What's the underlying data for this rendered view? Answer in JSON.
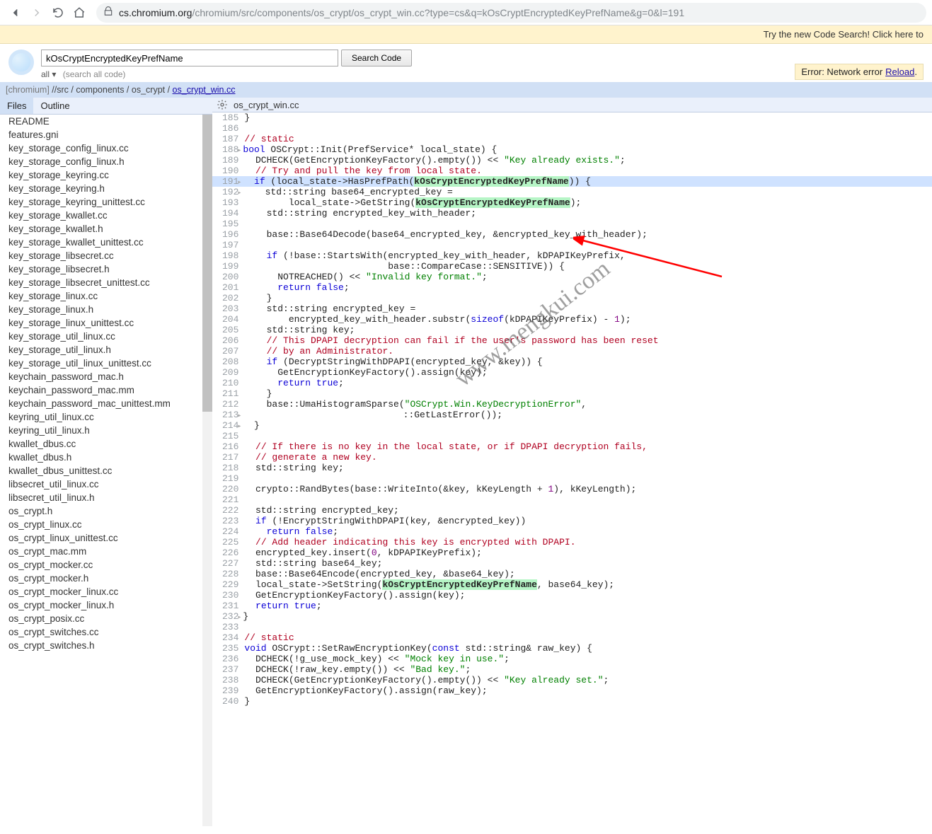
{
  "browser": {
    "url_host": "cs.chromium.org",
    "url_path": "/chromium/src/components/os_crypt/os_crypt_win.cc?type=cs&q=kOsCryptEncryptedKeyPrefName&g=0&l=191"
  },
  "banner_text": "Try the new Code Search! Click here to",
  "search": {
    "value": "kOsCryptEncryptedKeyPrefName",
    "button": "Search Code",
    "scope": "all ▾",
    "sub": "(search all code)"
  },
  "error": {
    "prefix": "Error: Network error ",
    "reload": "Reload",
    "dot": "."
  },
  "crumb": {
    "project": "[chromium]",
    "parts": [
      "src",
      "components",
      "os_crypt"
    ],
    "file": "os_crypt_win.cc"
  },
  "side_tabs": {
    "files": "Files",
    "outline": "Outline"
  },
  "files": [
    "README",
    "features.gni",
    "key_storage_config_linux.cc",
    "key_storage_config_linux.h",
    "key_storage_keyring.cc",
    "key_storage_keyring.h",
    "key_storage_keyring_unittest.cc",
    "key_storage_kwallet.cc",
    "key_storage_kwallet.h",
    "key_storage_kwallet_unittest.cc",
    "key_storage_libsecret.cc",
    "key_storage_libsecret.h",
    "key_storage_libsecret_unittest.cc",
    "key_storage_linux.cc",
    "key_storage_linux.h",
    "key_storage_linux_unittest.cc",
    "key_storage_util_linux.cc",
    "key_storage_util_linux.h",
    "key_storage_util_linux_unittest.cc",
    "keychain_password_mac.h",
    "keychain_password_mac.mm",
    "keychain_password_mac_unittest.mm",
    "keyring_util_linux.cc",
    "keyring_util_linux.h",
    "kwallet_dbus.cc",
    "kwallet_dbus.h",
    "kwallet_dbus_unittest.cc",
    "libsecret_util_linux.cc",
    "libsecret_util_linux.h",
    "os_crypt.h",
    "os_crypt_linux.cc",
    "os_crypt_linux_unittest.cc",
    "os_crypt_mac.mm",
    "os_crypt_mocker.cc",
    "os_crypt_mocker.h",
    "os_crypt_mocker_linux.cc",
    "os_crypt_mocker_linux.h",
    "os_crypt_posix.cc",
    "os_crypt_switches.cc",
    "os_crypt_switches.h"
  ],
  "code_title": "os_crypt_win.cc",
  "watermark": "www.mengkui.com",
  "code": [
    {
      "n": 185,
      "t": "}"
    },
    {
      "n": 186,
      "t": ""
    },
    {
      "n": 187,
      "t": "<span class='c-com'>// static</span>"
    },
    {
      "n": 188,
      "t": "<span class='c-kw'>bool</span> OSCrypt::Init(PrefService* local_state) {",
      "fold": true
    },
    {
      "n": 189,
      "t": "  DCHECK(GetEncryptionKeyFactory().empty()) &lt;&lt; <span class='c-str'>\"Key already exists.\"</span>;"
    },
    {
      "n": 190,
      "t": "  <span class='c-com'>// Try and pull the key from local state.</span>"
    },
    {
      "n": 191,
      "hl": true,
      "t": "  <span class='c-kw'>if</span> (local_state-&gt;HasPrefPath(<span class='hl-tok'>kOsCryptEncryptedKeyPrefName</span>)) {",
      "fold": true
    },
    {
      "n": 192,
      "t": "    std::string base64_encrypted_key =",
      "fold": true
    },
    {
      "n": 193,
      "t": "        local_state-&gt;GetString(<span class='hl-tok'>kOsCryptEncryptedKeyPrefName</span>);"
    },
    {
      "n": 194,
      "t": "    std::string encrypted_key_with_header;"
    },
    {
      "n": 195,
      "t": ""
    },
    {
      "n": 196,
      "t": "    base::Base64Decode(base64_encrypted_key, &amp;encrypted_key_with_header);"
    },
    {
      "n": 197,
      "t": ""
    },
    {
      "n": 198,
      "t": "    <span class='c-kw'>if</span> (!base::StartsWith(encrypted_key_with_header, kDPAPIKeyPrefix,"
    },
    {
      "n": 199,
      "t": "                          base::CompareCase::SENSITIVE)) {"
    },
    {
      "n": 200,
      "t": "      NOTREACHED() &lt;&lt; <span class='c-str'>\"Invalid key format.\"</span>;"
    },
    {
      "n": 201,
      "t": "      <span class='c-kw'>return</span> <span class='c-kw'>false</span>;"
    },
    {
      "n": 202,
      "t": "    }"
    },
    {
      "n": 203,
      "t": "    std::string encrypted_key ="
    },
    {
      "n": 204,
      "t": "        encrypted_key_with_header.substr(<span class='c-kw'>sizeof</span>(kDPAPIKeyPrefix) - <span class='c-num'>1</span>);"
    },
    {
      "n": 205,
      "t": "    std::string key;"
    },
    {
      "n": 206,
      "t": "    <span class='c-com'>// This DPAPI decryption can fail if the user's password has been reset</span>"
    },
    {
      "n": 207,
      "t": "    <span class='c-com'>// by an Administrator.</span>"
    },
    {
      "n": 208,
      "t": "    <span class='c-kw'>if</span> (DecryptStringWithDPAPI(encrypted_key, &amp;key)) {"
    },
    {
      "n": 209,
      "t": "      GetEncryptionKeyFactory().assign(key);"
    },
    {
      "n": 210,
      "t": "      <span class='c-kw'>return</span> <span class='c-kw'>true</span>;"
    },
    {
      "n": 211,
      "t": "    }"
    },
    {
      "n": 212,
      "t": "    base::UmaHistogramSparse(<span class='c-str'>\"OSCrypt.Win.KeyDecryptionError\"</span>,"
    },
    {
      "n": 213,
      "t": "                             ::GetLastError());",
      "fold": true
    },
    {
      "n": 214,
      "t": "  }",
      "fold": true
    },
    {
      "n": 215,
      "t": ""
    },
    {
      "n": 216,
      "t": "  <span class='c-com'>// If there is no key in the local state, or if DPAPI decryption fails,</span>"
    },
    {
      "n": 217,
      "t": "  <span class='c-com'>// generate a new key.</span>"
    },
    {
      "n": 218,
      "t": "  std::string key;"
    },
    {
      "n": 219,
      "t": ""
    },
    {
      "n": 220,
      "t": "  crypto::RandBytes(base::WriteInto(&amp;key, kKeyLength + <span class='c-num'>1</span>), kKeyLength);"
    },
    {
      "n": 221,
      "t": ""
    },
    {
      "n": 222,
      "t": "  std::string encrypted_key;"
    },
    {
      "n": 223,
      "t": "  <span class='c-kw'>if</span> (!EncryptStringWithDPAPI(key, &amp;encrypted_key))"
    },
    {
      "n": 224,
      "t": "    <span class='c-kw'>return</span> <span class='c-kw'>false</span>;"
    },
    {
      "n": 225,
      "t": "  <span class='c-com'>// Add header indicating this key is encrypted with DPAPI.</span>"
    },
    {
      "n": 226,
      "t": "  encrypted_key.insert(<span class='c-num'>0</span>, kDPAPIKeyPrefix);"
    },
    {
      "n": 227,
      "t": "  std::string base64_key;"
    },
    {
      "n": 228,
      "t": "  base::Base64Encode(encrypted_key, &amp;base64_key);"
    },
    {
      "n": 229,
      "t": "  local_state-&gt;SetString(<span class='hl-tok'>kOsCryptEncryptedKeyPrefName</span>, base64_key);"
    },
    {
      "n": 230,
      "t": "  GetEncryptionKeyFactory().assign(key);"
    },
    {
      "n": 231,
      "t": "  <span class='c-kw'>return</span> <span class='c-kw'>true</span>;"
    },
    {
      "n": 232,
      "t": "}",
      "fold": true
    },
    {
      "n": 233,
      "t": ""
    },
    {
      "n": 234,
      "t": "<span class='c-com'>// static</span>"
    },
    {
      "n": 235,
      "t": "<span class='c-kw'>void</span> OSCrypt::SetRawEncryptionKey(<span class='c-kw'>const</span> std::string&amp; raw_key) {"
    },
    {
      "n": 236,
      "t": "  DCHECK(!g_use_mock_key) &lt;&lt; <span class='c-str'>\"Mock key in use.\"</span>;"
    },
    {
      "n": 237,
      "t": "  DCHECK(!raw_key.empty()) &lt;&lt; <span class='c-str'>\"Bad key.\"</span>;"
    },
    {
      "n": 238,
      "t": "  DCHECK(GetEncryptionKeyFactory().empty()) &lt;&lt; <span class='c-str'>\"Key already set.\"</span>;"
    },
    {
      "n": 239,
      "t": "  GetEncryptionKeyFactory().assign(raw_key);"
    },
    {
      "n": 240,
      "t": "}"
    }
  ]
}
